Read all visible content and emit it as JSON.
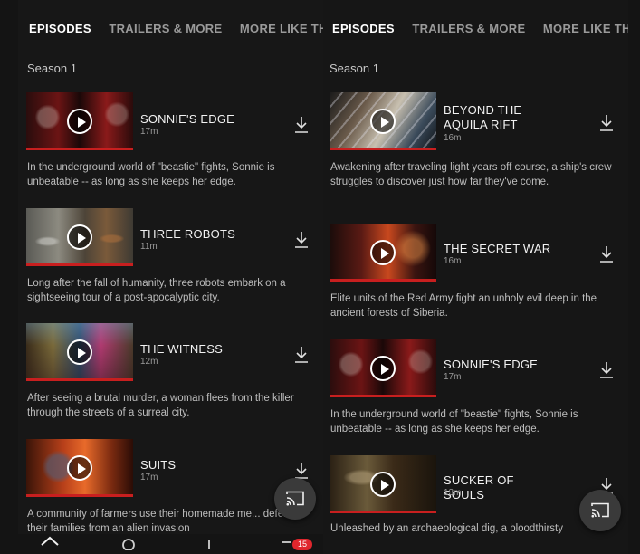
{
  "left_panel": {
    "tabs": [
      {
        "label": "EPISODES",
        "active": true
      },
      {
        "label": "TRAILERS & MORE",
        "active": false
      },
      {
        "label": "MORE LIKE TH",
        "active": false
      }
    ],
    "season": "Season 1",
    "episodes": [
      {
        "title": "SONNIE'S EDGE",
        "duration": "17m",
        "description": "In the underground world of \"beastie\" fights, Sonnie is unbeatable -- as long as she keeps her edge."
      },
      {
        "title": "THREE ROBOTS",
        "duration": "11m",
        "description": "Long after the fall of humanity, three robots embark on a sightseeing tour of a post-apocalyptic city."
      },
      {
        "title": "THE WITNESS",
        "duration": "12m",
        "description": "After seeing a brutal murder, a woman flees from the killer through the streets of a surreal city."
      },
      {
        "title": "SUITS",
        "duration": "17m",
        "description": "A community of farmers use their homemade me... defend their families from an alien invasion"
      }
    ],
    "nav_badge": "15"
  },
  "right_panel": {
    "tabs": [
      {
        "label": "EPISODES",
        "active": true
      },
      {
        "label": "TRAILERS & MORE",
        "active": false
      },
      {
        "label": "MORE LIKE TH",
        "active": false
      }
    ],
    "season": "Season 1",
    "episodes": [
      {
        "title": "BEYOND THE AQUILA RIFT",
        "duration": "16m",
        "description": "Awakening after traveling light years off course, a ship's crew struggles to discover just how far they've come."
      },
      {
        "title": "THE SECRET WAR",
        "duration": "16m",
        "description": "Elite units of the Red Army fight an unholy evil deep in the ancient forests of Siberia."
      },
      {
        "title": "SONNIE'S EDGE",
        "duration": "17m",
        "description": "In the underground world of \"beastie\" fights, Sonnie is unbeatable -- as long as she keeps her edge."
      },
      {
        "title": "SUCKER OF SOULS",
        "duration": "13m",
        "description": "Unleashed by an archaeological dig, a bloodthirsty"
      }
    ]
  },
  "colors": {
    "accent_red": "#c81f1f",
    "background": "#171717",
    "badge": "#e0262d"
  },
  "icons": {
    "download": "download-icon",
    "play": "play-icon",
    "cast": "cast-icon"
  }
}
